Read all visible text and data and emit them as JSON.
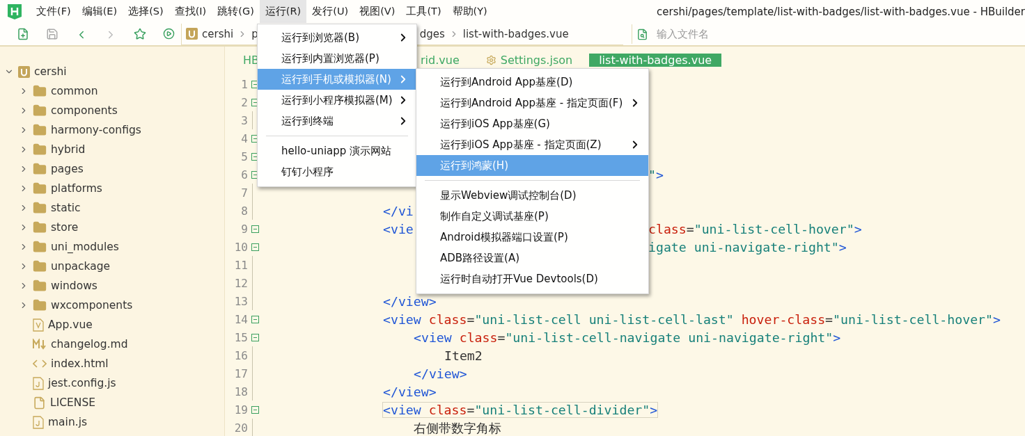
{
  "menubar": [
    {
      "label": "文件(F)",
      "selected": false
    },
    {
      "label": "编辑(E)",
      "selected": false
    },
    {
      "label": "选择(S)",
      "selected": false
    },
    {
      "label": "查找(I)",
      "selected": false
    },
    {
      "label": "跳转(G)",
      "selected": false
    },
    {
      "label": "运行(R)",
      "selected": true
    },
    {
      "label": "发行(U)",
      "selected": false
    },
    {
      "label": "视图(V)",
      "selected": false
    },
    {
      "label": "工具(T)",
      "selected": false
    },
    {
      "label": "帮助(Y)",
      "selected": false
    }
  ],
  "window": {
    "title": "cershi/pages/template/list-with-badges/list-with-badges.vue - HBuilder"
  },
  "breadcrumb": {
    "before_menu": [
      "cershi",
      "p"
    ],
    "after_menu": [
      "dges",
      "list-with-badges.vue"
    ]
  },
  "file_search": {
    "placeholder": "输入文件名"
  },
  "tree": [
    {
      "label": "cershi",
      "kind": "project",
      "expanded": true,
      "children": [
        {
          "label": "common",
          "kind": "folder",
          "expanded": false
        },
        {
          "label": "components",
          "kind": "folder",
          "expanded": false
        },
        {
          "label": "harmony-configs",
          "kind": "folder",
          "expanded": false
        },
        {
          "label": "hybrid",
          "kind": "folder",
          "expanded": false
        },
        {
          "label": "pages",
          "kind": "folder",
          "expanded": false
        },
        {
          "label": "platforms",
          "kind": "folder",
          "expanded": false
        },
        {
          "label": "static",
          "kind": "folder",
          "expanded": false
        },
        {
          "label": "store",
          "kind": "folder",
          "expanded": false
        },
        {
          "label": "uni_modules",
          "kind": "folder",
          "expanded": false
        },
        {
          "label": "unpackage",
          "kind": "folder",
          "expanded": false
        },
        {
          "label": "windows",
          "kind": "folder",
          "expanded": false
        },
        {
          "label": "wxcomponents",
          "kind": "folder",
          "expanded": false
        },
        {
          "label": "App.vue",
          "kind": "vue"
        },
        {
          "label": "changelog.md",
          "kind": "markdown"
        },
        {
          "label": "index.html",
          "kind": "html"
        },
        {
          "label": "jest.config.js",
          "kind": "js"
        },
        {
          "label": "LICENSE",
          "kind": "file"
        },
        {
          "label": "main.js",
          "kind": "js"
        }
      ]
    }
  ],
  "tabs": [
    {
      "label": "HB",
      "selected": false,
      "kind": "plain"
    },
    {
      "label": "rid.vue",
      "selected": false,
      "kind": "plain"
    },
    {
      "label": "Settings.json",
      "selected": false,
      "kind": "settings"
    },
    {
      "label": "list-with-badges.vue",
      "selected": true,
      "kind": "plain"
    }
  ],
  "code_lines": [
    {
      "number": "1",
      "fold": true
    },
    {
      "number": "2",
      "fold": true
    },
    {
      "number": "3",
      "fold": false
    },
    {
      "number": "4",
      "fold": true
    },
    {
      "number": "5",
      "fold": true
    },
    {
      "number": "6",
      "fold": true,
      "tail": [
        {
          "kind": "string",
          "text": "\""
        },
        {
          "kind": "tag",
          "text": ">"
        }
      ]
    },
    {
      "number": "7",
      "fold": false
    },
    {
      "number": "8",
      "fold": false,
      "tokens": [
        {
          "kind": "tag",
          "text": "</vi"
        }
      ]
    },
    {
      "number": "9",
      "fold": true,
      "tokens": [
        {
          "kind": "tag",
          "text": "<vie"
        }
      ],
      "tail": [
        {
          "kind": "attr",
          "text": "class"
        },
        {
          "kind": "plain",
          "text": "="
        },
        {
          "kind": "string",
          "text": "\"uni-list-cell-hover\""
        },
        {
          "kind": "tag",
          "text": ">"
        }
      ]
    },
    {
      "number": "10",
      "fold": true,
      "tail": [
        {
          "kind": "string",
          "text": "igate uni-navigate-right\""
        },
        {
          "kind": "tag",
          "text": ">"
        }
      ]
    },
    {
      "number": "11",
      "fold": false
    },
    {
      "number": "12",
      "fold": false
    },
    {
      "number": "13",
      "fold": false,
      "tokens": [
        {
          "kind": "tag",
          "text": "</view>"
        }
      ]
    },
    {
      "number": "14",
      "fold": true,
      "tokens": [
        {
          "kind": "tag",
          "text": "<view"
        },
        {
          "kind": "attr",
          "text": " class"
        },
        {
          "kind": "plain",
          "text": "="
        },
        {
          "kind": "string",
          "text": "\"uni-list-cell uni-list-cell-last\""
        },
        {
          "kind": "attr",
          "text": " hover-class"
        },
        {
          "kind": "plain",
          "text": "="
        },
        {
          "kind": "string",
          "text": "\"uni-list-cell-hover\""
        },
        {
          "kind": "tag",
          "text": ">"
        }
      ]
    },
    {
      "number": "15",
      "fold": true,
      "tokens": [
        {
          "kind": "tag",
          "text": "<view"
        },
        {
          "kind": "attr",
          "text": " class"
        },
        {
          "kind": "plain",
          "text": "="
        },
        {
          "kind": "string",
          "text": "\"uni-list-cell-navigate uni-navigate-right\""
        },
        {
          "kind": "tag",
          "text": ">"
        }
      ]
    },
    {
      "number": "16",
      "fold": false,
      "tokens": [
        {
          "kind": "plain",
          "text": "Item2"
        }
      ]
    },
    {
      "number": "17",
      "fold": false,
      "tokens": [
        {
          "kind": "tag",
          "text": "</view>"
        }
      ]
    },
    {
      "number": "18",
      "fold": false,
      "tokens": [
        {
          "kind": "tag",
          "text": "</view>"
        }
      ]
    },
    {
      "number": "19",
      "fold": true,
      "boxed": true,
      "tokens": [
        {
          "kind": "tag",
          "text": "<view"
        },
        {
          "kind": "attr",
          "text": " class"
        },
        {
          "kind": "plain",
          "text": "="
        },
        {
          "kind": "string",
          "text": "\"uni-list-cell-divider\""
        },
        {
          "kind": "tag",
          "text": ">"
        }
      ]
    },
    {
      "number": "20",
      "fold": false,
      "tokens": [
        {
          "kind": "plain",
          "text": "右侧带数字角标"
        }
      ]
    }
  ],
  "run_menu": [
    {
      "label": "运行到浏览器(B)",
      "submenu": true,
      "selected": false
    },
    {
      "label": "运行到内置浏览器(P)",
      "submenu": false,
      "selected": false
    },
    {
      "label": "运行到手机或模拟器(N)",
      "submenu": true,
      "selected": true
    },
    {
      "label": "运行到小程序模拟器(M)",
      "submenu": true,
      "selected": false
    },
    {
      "label": "运行到终端",
      "submenu": true,
      "selected": false
    },
    {
      "kind": "separator"
    },
    {
      "label": "hello-uniapp 演示网站",
      "submenu": false,
      "selected": false
    },
    {
      "label": "钉钉小程序",
      "submenu": false,
      "selected": false
    }
  ],
  "device_menu": [
    {
      "label": "运行到Android App基座(D)",
      "submenu": false,
      "selected": false
    },
    {
      "label": "运行到Android App基座 - 指定页面(F)",
      "submenu": true,
      "selected": false
    },
    {
      "label": "运行到iOS App基座(G)",
      "submenu": false,
      "selected": false
    },
    {
      "label": "运行到iOS App基座 - 指定页面(Z)",
      "submenu": true,
      "selected": false
    },
    {
      "label": "运行到鸿蒙(H)",
      "submenu": false,
      "selected": true
    },
    {
      "kind": "separator"
    },
    {
      "label": "显示Webview调试控制台(D)",
      "submenu": false,
      "selected": false
    },
    {
      "label": "制作自定义调试基座(P)",
      "submenu": false,
      "selected": false
    },
    {
      "label": "Android模拟器端口设置(P)",
      "submenu": false,
      "selected": false
    },
    {
      "label": "ADB路径设置(A)",
      "submenu": false,
      "selected": false
    },
    {
      "label": "运行时自动打开Vue Devtools(D)",
      "submenu": false,
      "selected": false
    }
  ]
}
